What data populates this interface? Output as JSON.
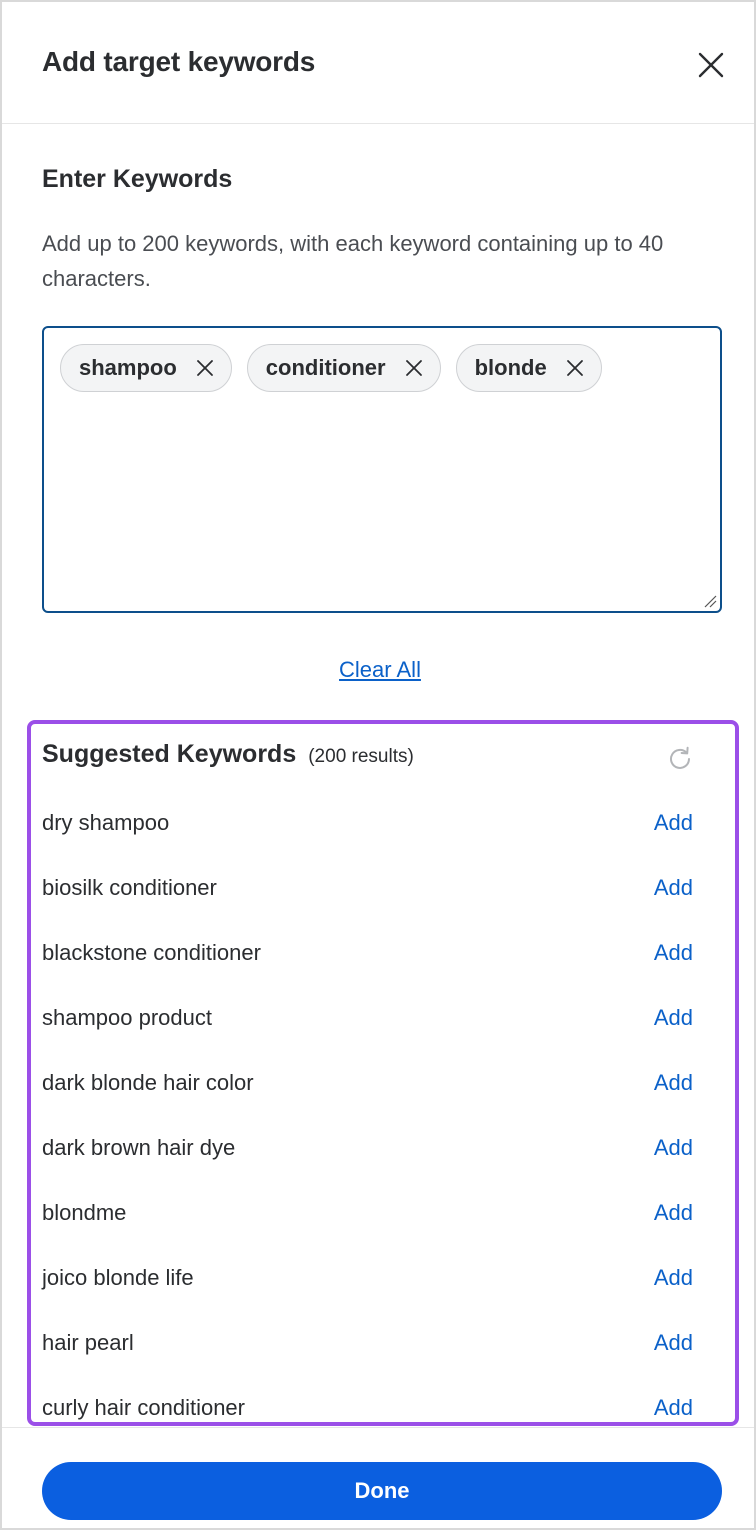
{
  "header": {
    "title": "Add target keywords"
  },
  "enter_section": {
    "title": "Enter Keywords",
    "help_text": "Add up to 200 keywords, with each keyword containing up to 40 characters.",
    "chips": [
      {
        "label": "shampoo"
      },
      {
        "label": "conditioner"
      },
      {
        "label": "blonde"
      }
    ],
    "clear_all_label": "Clear All"
  },
  "suggested": {
    "title": "Suggested Keywords",
    "count_text": "(200 results)",
    "items": [
      {
        "label": "dry shampoo",
        "action": "Add"
      },
      {
        "label": "biosilk conditioner",
        "action": "Add"
      },
      {
        "label": "blackstone conditioner",
        "action": "Add"
      },
      {
        "label": "shampoo product",
        "action": "Add"
      },
      {
        "label": "dark blonde hair color",
        "action": "Add"
      },
      {
        "label": "dark brown hair dye",
        "action": "Add"
      },
      {
        "label": "blondme",
        "action": "Add"
      },
      {
        "label": "joico blonde life",
        "action": "Add"
      },
      {
        "label": "hair pearl",
        "action": "Add"
      },
      {
        "label": "curly hair conditioner",
        "action": "Add"
      }
    ]
  },
  "footer": {
    "done_label": "Done"
  },
  "icons": {
    "close": "close-icon",
    "chip_remove": "close-icon",
    "refresh": "refresh-icon"
  },
  "colors": {
    "accent": "#0b5fe0",
    "link": "#0b61c9",
    "input_border": "#0d4f8b",
    "highlight_border": "#9b4fe8",
    "text": "#2b2d30"
  }
}
